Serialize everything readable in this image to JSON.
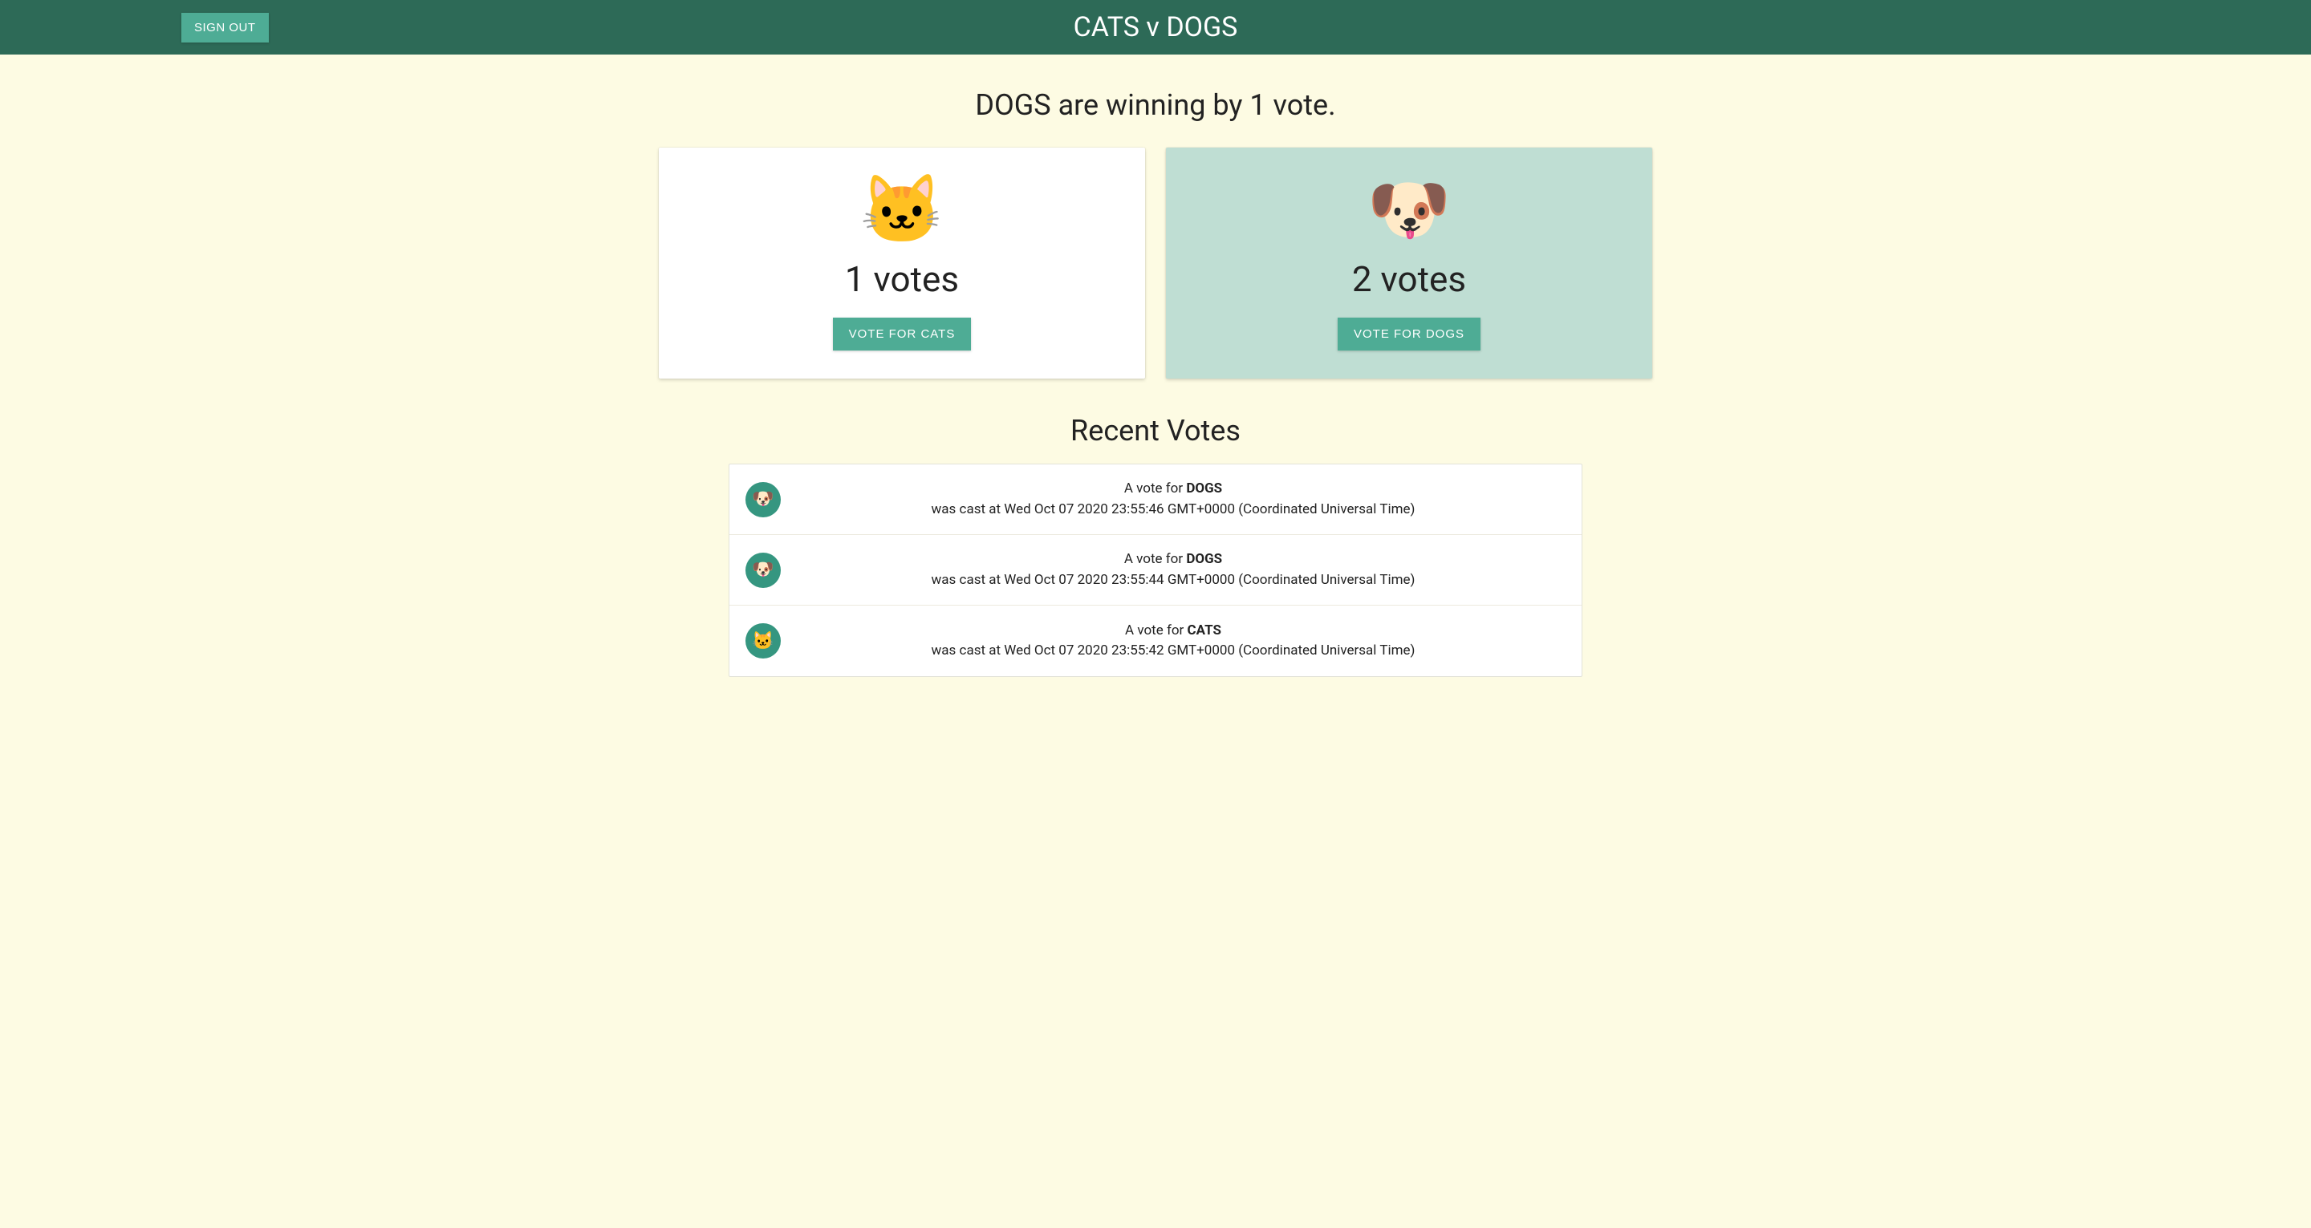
{
  "header": {
    "signout_label": "SIGN OUT",
    "title": "CATS v DOGS"
  },
  "status_line": "DOGS are winning by 1 vote.",
  "cards": {
    "cats": {
      "emoji": "🐱",
      "votes_text": "1 votes",
      "button_label": "VOTE FOR CATS"
    },
    "dogs": {
      "emoji": "🐶",
      "votes_text": "2 votes",
      "button_label": "VOTE FOR DOGS"
    }
  },
  "recent": {
    "title": "Recent Votes",
    "items": [
      {
        "emoji": "🐶",
        "line1_prefix": "A vote for ",
        "line1_bold": "DOGS",
        "line2": "was cast at Wed Oct 07 2020 23:55:46 GMT+0000 (Coordinated Universal Time)"
      },
      {
        "emoji": "🐶",
        "line1_prefix": "A vote for ",
        "line1_bold": "DOGS",
        "line2": "was cast at Wed Oct 07 2020 23:55:44 GMT+0000 (Coordinated Universal Time)"
      },
      {
        "emoji": "🐱",
        "line1_prefix": "A vote for ",
        "line1_bold": "CATS",
        "line2": "was cast at Wed Oct 07 2020 23:55:42 GMT+0000 (Coordinated Universal Time)"
      }
    ]
  }
}
